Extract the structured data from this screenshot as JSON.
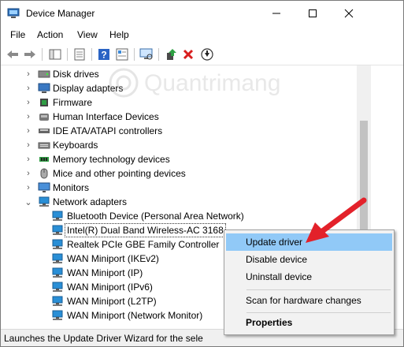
{
  "window": {
    "title": "Device Manager"
  },
  "menu": [
    "File",
    "Action",
    "View",
    "Help"
  ],
  "toolbar_icons": [
    "back-arrow-icon",
    "forward-arrow-icon",
    "show-hide-tree-icon",
    "properties-icon",
    "help-icon",
    "scan-hardware-icon",
    "update-driver-icon",
    "uninstall-icon",
    "download-icon"
  ],
  "tree": {
    "categories": [
      {
        "label": "Disk drives",
        "icon": "disk-drive-icon"
      },
      {
        "label": "Display adapters",
        "icon": "display-adapter-icon"
      },
      {
        "label": "Firmware",
        "icon": "firmware-icon"
      },
      {
        "label": "Human Interface Devices",
        "icon": "hid-icon"
      },
      {
        "label": "IDE ATA/ATAPI controllers",
        "icon": "ide-controller-icon"
      },
      {
        "label": "Keyboards",
        "icon": "keyboard-icon"
      },
      {
        "label": "Memory technology devices",
        "icon": "memory-device-icon"
      },
      {
        "label": "Mice and other pointing devices",
        "icon": "mouse-icon"
      },
      {
        "label": "Monitors",
        "icon": "monitor-icon"
      },
      {
        "label": "Network adapters",
        "icon": "network-adapter-icon"
      }
    ],
    "network_children": [
      "Bluetooth Device (Personal Area Network)",
      "Intel(R) Dual Band Wireless-AC 3168",
      "Realtek PCIe GBE Family Controller",
      "WAN Miniport (IKEv2)",
      "WAN Miniport (IP)",
      "WAN Miniport (IPv6)",
      "WAN Miniport (L2TP)",
      "WAN Miniport (Network Monitor)"
    ]
  },
  "context_menu": {
    "update": "Update driver",
    "disable": "Disable device",
    "uninstall": "Uninstall device",
    "scan": "Scan for hardware changes",
    "properties": "Properties"
  },
  "status": "Launches the Update Driver Wizard for the sele",
  "watermark": "Quantrimang",
  "colors": {
    "highlight": "#91c9f7",
    "arrow": "#e3212a",
    "network_icon": "#2a8fd6"
  }
}
